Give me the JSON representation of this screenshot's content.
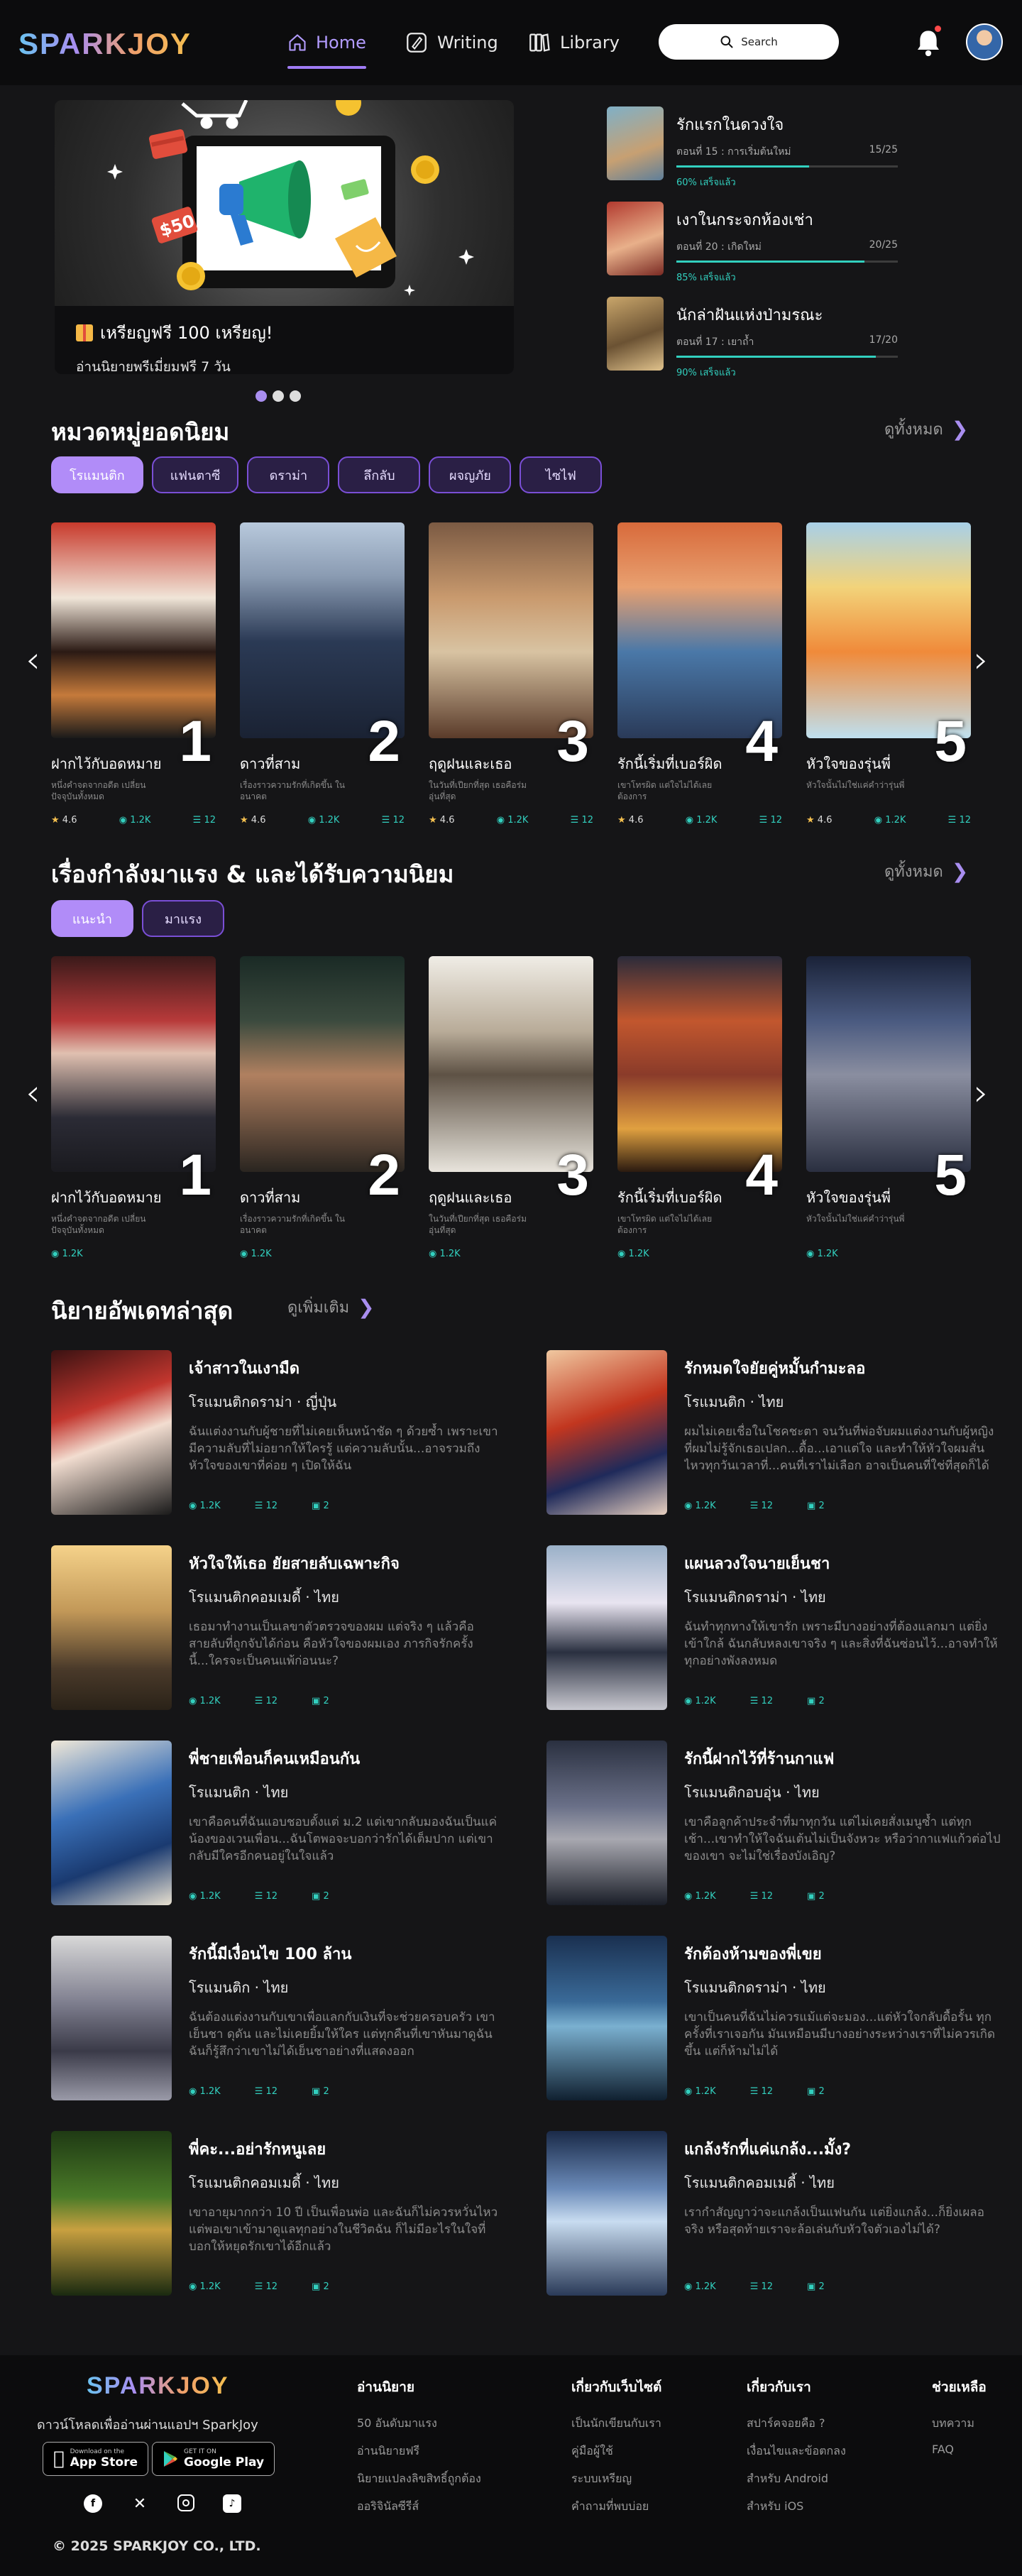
{
  "header": {
    "logo": "SPARKJOY",
    "nav": [
      {
        "label": "Home",
        "active": true
      },
      {
        "label": "Writing",
        "active": false
      },
      {
        "label": "Library",
        "active": false
      }
    ],
    "search_label": "Search",
    "accent": "#a07cf5"
  },
  "hero": {
    "title": "เหรียญฟรี 100 เหรียญ!",
    "subtitle": "อ่านนิยายพรีเมี่ยมฟรี 7 วัน",
    "price_tag": "$50",
    "dots": 3
  },
  "continue_reading": [
    {
      "title": "รักแรกในดวงใจ",
      "episode": "ตอนที่ 15 : การเริ่มต้นใหม่",
      "progress_text": "15/25",
      "percent_label": "60% เสร็จแล้ว",
      "progress": 0.6
    },
    {
      "title": "เงาในกระจกห้องเช่า",
      "episode": "ตอนที่ 20 : เกิดใหม่",
      "progress_text": "20/25",
      "percent_label": "85% เสร็จแล้ว",
      "progress": 0.85
    },
    {
      "title": "นักล่าฝันแห่งป่ามรณะ",
      "episode": "ตอนที่ 17 : เยาถ้ำ",
      "progress_text": "17/20",
      "percent_label": "90% เสร็จแล้ว",
      "progress": 0.9
    }
  ],
  "popular": {
    "title": "หมวดหมู่ยอดนิยม",
    "see_all": "ดูทั้งหมด",
    "tabs": [
      "โรแมนติก",
      "แฟนตาซี",
      "ดราม่า",
      "ลึกลับ",
      "ผจญภัย",
      "ไซไฟ"
    ],
    "active_tab": 0,
    "books": [
      {
        "rank": "1",
        "title": "ฝากไว้กับอดหมาย",
        "desc": "หนึ่งคำจดจากอดีต เปลี่ยนปัจจุบันทั้งหมด",
        "rating": "4.6",
        "views": "1.2K",
        "chapters": "12"
      },
      {
        "rank": "2",
        "title": "ดาวที่สาม",
        "desc": "เรื่องราวความรักที่เกิดขึ้น ในอนาคต",
        "rating": "4.6",
        "views": "1.2K",
        "chapters": "12"
      },
      {
        "rank": "3",
        "title": "ฤดูฝนและเธอ",
        "desc": "ในวันที่เปียกที่สุด เธอคือร่มอุ่นที่สุด",
        "rating": "4.6",
        "views": "1.2K",
        "chapters": "12"
      },
      {
        "rank": "4",
        "title": "รักนี้เริ่มที่เบอร์ผิด",
        "desc": "เขาโทรผิด แต่ใจไม่ได้เลยต้องการ",
        "rating": "4.6",
        "views": "1.2K",
        "chapters": "12"
      },
      {
        "rank": "5",
        "title": "หัวใจของรุ่นพี่",
        "desc": "หัวใจนั้นไม่ใช่แค่คำว่ารุ่นพี่",
        "rating": "4.6",
        "views": "1.2K",
        "chapters": "12"
      }
    ]
  },
  "trending": {
    "title": "เรื่องกำลังมาแรง & และได้รับความนิยม",
    "see_all": "ดูทั้งหมด",
    "tabs": [
      "แนะนำ",
      "มาแรง"
    ],
    "active_tab": 0,
    "books": [
      {
        "rank": "1",
        "title": "ฝากไว้กับอดหมาย",
        "desc": "หนึ่งคำจดจากอดีต เปลี่ยนปัจจุบันทั้งหมด",
        "views": "1.2K"
      },
      {
        "rank": "2",
        "title": "ดาวที่สาม",
        "desc": "เรื่องราวความรักที่เกิดขึ้น ในอนาคต",
        "views": "1.2K"
      },
      {
        "rank": "3",
        "title": "ฤดูฝนและเธอ",
        "desc": "ในวันที่เปียกที่สุด เธอคือร่มอุ่นที่สุด",
        "views": "1.2K"
      },
      {
        "rank": "4",
        "title": "รักนี้เริ่มที่เบอร์ผิด",
        "desc": "เขาโทรผิด แต่ใจไม่ได้เลยต้องการ",
        "views": "1.2K"
      },
      {
        "rank": "5",
        "title": "หัวใจของรุ่นพี่",
        "desc": "หัวใจนั้นไม่ใช่แค่คำว่ารุ่นพี่",
        "views": "1.2K"
      }
    ]
  },
  "latest": {
    "title": "นิยายอัพเดทล่าสุด",
    "see_more": "ดูเพิ่มเติม",
    "novels": [
      {
        "title": "เจ้าสาวในเงามืด",
        "genre": "โรแมนติกดราม่า · ญี่ปุ่น",
        "desc": "ฉันแต่งงานกับผู้ชายที่ไม่เคยเห็นหน้าชัด ๆ ด้วยซ้ำ เพราะเขามีความลับที่ไม่อยากให้ใครรู้ แต่ความลับนั้น...อาจรวมถึงหัวใจของเขาที่ค่อย ๆ เปิดให้ฉัน",
        "views": "1.2K",
        "chapters": "12",
        "comments": "2"
      },
      {
        "title": "รักหมดใจยัยคู่หมั้นกำมะลอ",
        "genre": "โรแมนติก · ไทย",
        "desc": "ผมไม่เคยเชื่อในโชคชะตา จนวันที่พ่อจับผมแต่งงานกับผู้หญิงที่ผมไม่รู้จักเธอเปลก...ดื้อ...เอาแต่ใจ และทำให้หัวใจผมสั่นไหวทุกวันเวลาที่...คนที่เราไม่เลือก อาจเป็นคนที่ใช่ที่สุดก็ได้",
        "views": "1.2K",
        "chapters": "12",
        "comments": "2"
      },
      {
        "title": "หัวใจให้เธอ ยัยสายลับเฉพาะกิจ",
        "genre": "โรแมนติกคอมเมดี้ · ไทย",
        "desc": "เธอมาทำงานเป็นเลขาตัวตรวจของผม แต่จริง ๆ แล้วคือสายลับที่ถูกจับได้ก่อน คือหัวใจของผมเอง ภารกิจรักครั้งนี้...ใครจะเป็นคนแพ้ก่อนนะ?",
        "views": "1.2K",
        "chapters": "12",
        "comments": "2"
      },
      {
        "title": "แผนลวงใจนายเย็นชา",
        "genre": "โรแมนติกดราม่า · ไทย",
        "desc": "ฉันทำทุกทางให้เขารัก เพราะมีบางอย่างที่ต้องแลกมา แต่ยิ่งเข้าใกล้ ฉันกลับหลงเขาจริง ๆ และสิ่งที่ฉันซ่อนไว้...อาจทำให้ทุกอย่างพังลงหมด",
        "views": "1.2K",
        "chapters": "12",
        "comments": "2"
      },
      {
        "title": "พี่ชายเพื่อนก็คนเหมือนกัน",
        "genre": "โรแมนติก · ไทย",
        "desc": "เขาคือคนที่ฉันแอบชอบตั้งแต่ ม.2 แต่เขากลับมองฉันเป็นแค่น้องของเวนเพื่อน...ฉันโตพอจะบอกว่ารักได้เต็มปาก แต่เขากลับมีใครอีกคนอยู่ในใจแล้ว",
        "views": "1.2K",
        "chapters": "12",
        "comments": "2"
      },
      {
        "title": "รักนี้ฝากไว้ที่ร้านกาแฟ",
        "genre": "โรแมนติกอบอุ่น · ไทย",
        "desc": "เขาคือลูกค้าประจำที่มาทุกวัน แต่ไม่เคยสั่งเมนูซ้ำ แต่ทุกเช้า...เขาทำให้ใจฉันเต้นไม่เป็นจังหวะ หรือว่ากาแฟแก้วต่อไปของเขา จะไม่ใช่เรื่องบังเอิญ?",
        "views": "1.2K",
        "chapters": "12",
        "comments": "2"
      },
      {
        "title": "รักนี้มีเงื่อนไข 100 ล้าน",
        "genre": "โรแมนติก · ไทย",
        "desc": "ฉันต้องแต่งงานกับเขาเพื่อแลกกับเงินที่จะช่วยครอบครัว เขาเย็นชา ดุดัน และไม่เคยยิ้มให้ใคร แต่ทุกคืนที่เขาหันมาดูฉัน ฉันก็รู้สึกว่าเขาไม่ได้เย็นชาอย่างที่แสดงออก",
        "views": "1.2K",
        "chapters": "12",
        "comments": "2"
      },
      {
        "title": "รักต้องห้ามของพี่เขย",
        "genre": "โรแมนติกดราม่า · ไทย",
        "desc": "เขาเป็นคนที่ฉันไม่ควรแม้แต่จะมอง...แต่หัวใจกลับดื้อรั้น ทุกครั้งที่เราเจอกัน มันเหมือนมีบางอย่างระหว่างเราที่ไม่ควรเกิดขึ้น แต่ก็ห้ามไม่ได้",
        "views": "1.2K",
        "chapters": "12",
        "comments": "2"
      },
      {
        "title": "พี่คะ...อย่ารักหนูเลย",
        "genre": "โรแมนติกคอมเมดี้ · ไทย",
        "desc": "เขาอายุมากกว่า 10 ปี เป็นเพื่อนพ่อ และฉันก็ไม่ควรหวั่นไหว แต่พอเขาเข้ามาดูแลทุกอย่างในชีวิตฉัน ก็ไม่มีอะไรในใจที่บอกให้หยุดรักเขาได้อีกแล้ว",
        "views": "1.2K",
        "chapters": "12",
        "comments": "2"
      },
      {
        "title": "แกล้งรักที่แค่แกล้ง...มั้ง?",
        "genre": "โรแมนติกคอมเมดี้ · ไทย",
        "desc": "เรากำสัญญาว่าจะแกล้งเป็นแฟนกัน แต่ยิ่งแกล้ง...ก็ยิ่งเผลอจริง หรือสุดท้ายเราจะล้อเล่นกับหัวใจตัวเองไม่ได้?",
        "views": "1.2K",
        "chapters": "12",
        "comments": "2"
      }
    ]
  },
  "footer": {
    "logo": "SPARKJOY",
    "download_text": "ดาวน์โหลดเพื่ออ่านผ่านแอปฯ SparkJoy",
    "app_store_small": "Download on the",
    "app_store": "App Store",
    "google_play_small": "GET IT ON",
    "google_play": "Google Play",
    "copyright": "© 2025 SPARKJOY CO., LTD.",
    "columns": [
      {
        "heading": "อ่านนิยาย",
        "items": [
          "50 อันดับมาแรง",
          "อ่านนิยายฟรี",
          "นิยายแปลงลิขสิทธิ์ถูกต้อง",
          "ออริจินัลซีรีส์"
        ]
      },
      {
        "heading": "เกี่ยวกับเว็บไซต์",
        "items": [
          "เป็นนักเขียนกับเรา",
          "คู่มือผู้ใช้",
          "ระบบเหรียญ",
          "คำถามที่พบบ่อย"
        ]
      },
      {
        "heading": "เกี่ยวกับเรา",
        "items": [
          "สปาร์คจอยคือ ?",
          "เงื่อนไขและข้อตกลง",
          "สำหรับ Android",
          "สำหรับ iOS"
        ]
      },
      {
        "heading": "ช่วยเหลือ",
        "items": [
          "บทความ",
          "FAQ"
        ]
      }
    ]
  }
}
